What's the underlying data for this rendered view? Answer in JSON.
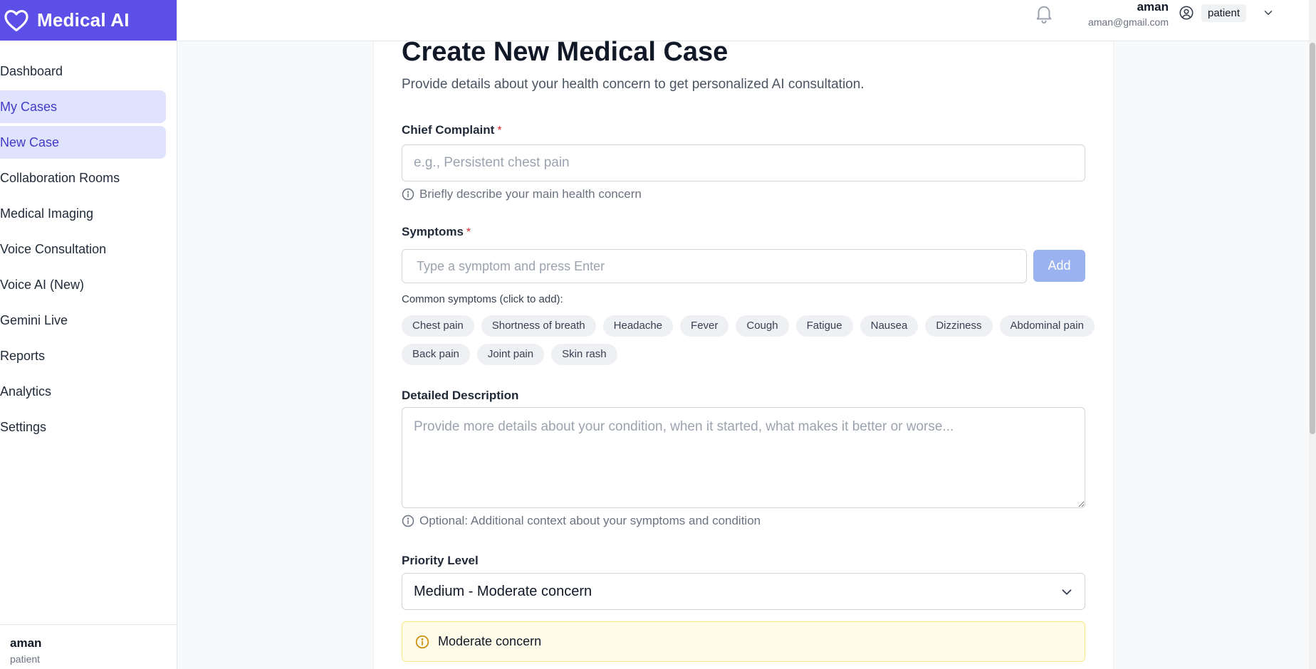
{
  "app": {
    "title": "Medical AI"
  },
  "sidebar": {
    "items": [
      {
        "label": "Dashboard",
        "active": false
      },
      {
        "label": "My Cases",
        "active": true
      },
      {
        "label": "New Case",
        "active": true
      },
      {
        "label": "Collaboration Rooms",
        "active": false
      },
      {
        "label": "Medical Imaging",
        "active": false
      },
      {
        "label": "Voice Consultation",
        "active": false
      },
      {
        "label": "Voice AI (New)",
        "active": false
      },
      {
        "label": "Gemini Live",
        "active": false
      },
      {
        "label": "Reports",
        "active": false
      },
      {
        "label": "Analytics",
        "active": false
      },
      {
        "label": "Settings",
        "active": false
      }
    ],
    "footer": {
      "name": "aman",
      "role": "patient"
    }
  },
  "header": {
    "user_name": "aman",
    "user_email": "aman@gmail.com",
    "role": "patient"
  },
  "page": {
    "title": "Create New Medical Case",
    "subtitle": "Provide details about your health concern to get personalized AI consultation."
  },
  "form": {
    "chief_complaint": {
      "label": "Chief Complaint",
      "required_mark": "*",
      "placeholder": "e.g., Persistent chest pain",
      "value": "",
      "hint": "Briefly describe your main health concern"
    },
    "symptoms": {
      "label": "Symptoms",
      "required_mark": "*",
      "placeholder": "Type a symptom and press Enter",
      "value": "",
      "add_label": "Add",
      "common_label": "Common symptoms (click to add):",
      "common": [
        "Chest pain",
        "Shortness of breath",
        "Headache",
        "Fever",
        "Cough",
        "Fatigue",
        "Nausea",
        "Dizziness",
        "Abdominal pain",
        "Back pain",
        "Joint pain",
        "Skin rash"
      ]
    },
    "description": {
      "label": "Detailed Description",
      "placeholder": "Provide more details about your condition, when it started, what makes it better or worse...",
      "value": "",
      "hint": "Optional: Additional context about your symptoms and condition"
    },
    "priority": {
      "label": "Priority Level",
      "selected": "Medium - Moderate concern",
      "alert_text": "Moderate concern"
    }
  },
  "icons": {
    "brand": "heart-icon",
    "notifications": "bell-icon",
    "user": "user-circle-icon",
    "menu": "chevron-down-icon",
    "info": "info-icon",
    "alert": "info-circle-icon"
  },
  "colors": {
    "brand": "#5b4fe8",
    "active_nav_bg": "#e0e3fd",
    "active_nav_text": "#3f3bc8",
    "add_button": "#9bb2f0",
    "required": "#dc2626",
    "alert_bg": "#fefce8",
    "alert_icon": "#ca8a04"
  }
}
